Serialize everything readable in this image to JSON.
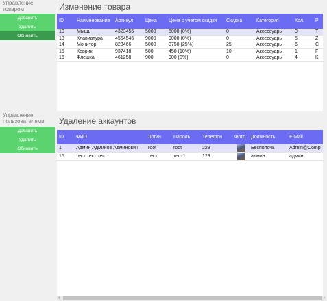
{
  "sidebar": {
    "products": {
      "title_line1": "Управление",
      "title_line2": "товаром",
      "add": "Добавить",
      "delete": "Удалить",
      "refresh": "Обновить"
    },
    "users": {
      "title_line1": "Управление",
      "title_line2": "пользователями",
      "add": "Добавить",
      "delete": "Удалить",
      "refresh": "Обновить"
    }
  },
  "products_panel": {
    "title": "Изменение товара",
    "columns": [
      "ID",
      "Наименование",
      "Артикул",
      "Цена",
      "Цена с учетом скидки",
      "Скидка",
      "Категория",
      "Кол.",
      "Р"
    ],
    "rows": [
      [
        "10",
        "Мышь",
        "4323455",
        "5000",
        "5000 (0%)",
        "0",
        "Аксессуары",
        "0",
        "Т"
      ],
      [
        "13",
        "Клавиатура",
        "4554545",
        "9000",
        "9000 (0%)",
        "0",
        "Аксессуары",
        "5",
        "Z"
      ],
      [
        "14",
        "Монитор",
        "823466",
        "5000",
        "3750 (25%)",
        "25",
        "Аксессуары",
        "6",
        "C"
      ],
      [
        "15",
        "Коврик",
        "937418",
        "500",
        "450 (10%)",
        "10",
        "Аксессуары",
        "1",
        "F"
      ],
      [
        "16",
        "Флешка",
        "461258",
        "900",
        "900 (0%)",
        "0",
        "Аксессуары",
        "4",
        "K"
      ]
    ]
  },
  "accounts_panel": {
    "title": "Удаление аккаунтов",
    "columns": [
      "ID",
      "ФИО",
      "Логин",
      "Пароль",
      "Телефон",
      "Фото",
      "Должность",
      "E-Mail"
    ],
    "rows": [
      [
        "1",
        "Админ Админов Админович",
        "root",
        "root",
        "228",
        "",
        "Бесполочь",
        "Admin@Comp"
      ],
      [
        "15",
        "тест тест тест",
        "тест",
        "тест1",
        "123",
        "",
        "админ",
        "админ"
      ]
    ]
  },
  "scrollbar": {
    "left_arrow": "‹",
    "right_arrow": "›"
  },
  "colors": {
    "header": "#6b6cf2",
    "button_green": "#5bd36e",
    "button_dark": "#3a9a4e",
    "selected_row": "#e2e2f8"
  }
}
